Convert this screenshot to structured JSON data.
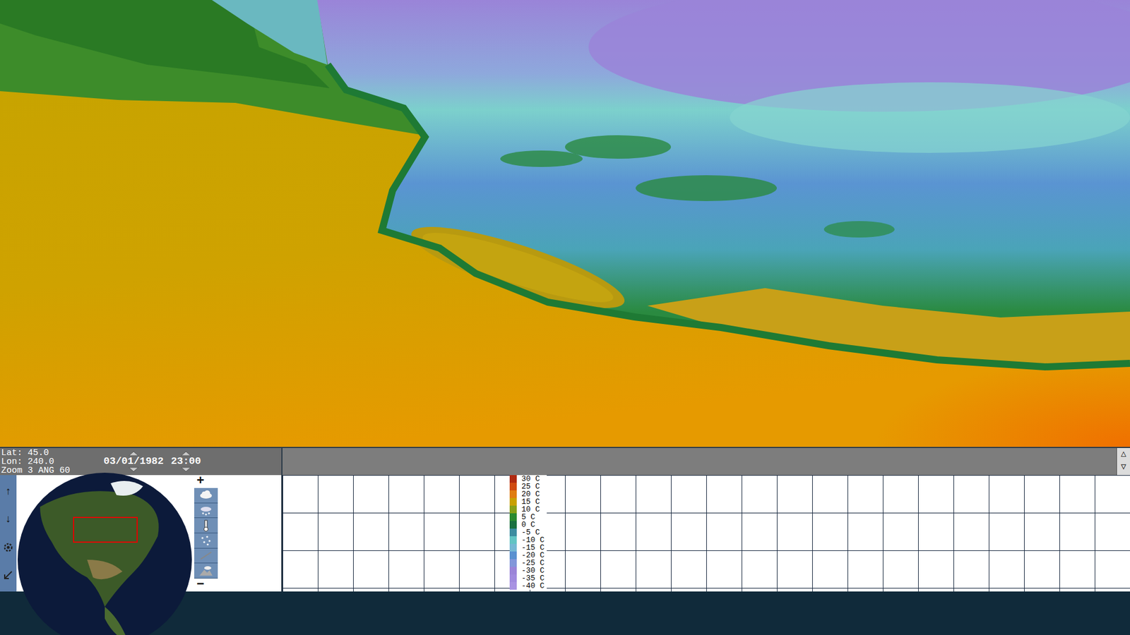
{
  "readout": [
    {
      "label": "Lat:",
      "value": "45.0"
    },
    {
      "label": "Lon:",
      "value": "240.0"
    }
  ],
  "zoom": {
    "label": "Zoom",
    "value": "3"
  },
  "angle": {
    "label": "ANG",
    "value": "60"
  },
  "date": "03/01/1982",
  "time": "23:00",
  "nav": {
    "up": "↑",
    "down": "↓"
  },
  "zoom_buttons": {
    "plus": "+",
    "minus": "−"
  },
  "scroll": {
    "up": "△",
    "down": "▽"
  },
  "legend": {
    "ticks": [
      {
        "label": "30 C",
        "color": "#b02a10"
      },
      {
        "label": "25 C",
        "color": "#d04a10"
      },
      {
        "label": "20 C",
        "color": "#e07c10"
      },
      {
        "label": "15 C",
        "color": "#c8a000"
      },
      {
        "label": "10 C",
        "color": "#86a018"
      },
      {
        "label": "5 C",
        "color": "#2a8a30"
      },
      {
        "label": "0 C",
        "color": "#1a7040"
      },
      {
        "label": "-5 C",
        "color": "#3c8ca0"
      },
      {
        "label": "-10 C",
        "color": "#62c4c4"
      },
      {
        "label": "-15 C",
        "color": "#74b8d4"
      },
      {
        "label": "-20 C",
        "color": "#5a90d0"
      },
      {
        "label": "-25 C",
        "color": "#8296da"
      },
      {
        "label": "-30 C",
        "color": "#9a84d8"
      },
      {
        "label": "-35 C",
        "color": "#a08ade"
      },
      {
        "label": "-40 C",
        "color": "#a892e2"
      }
    ]
  }
}
